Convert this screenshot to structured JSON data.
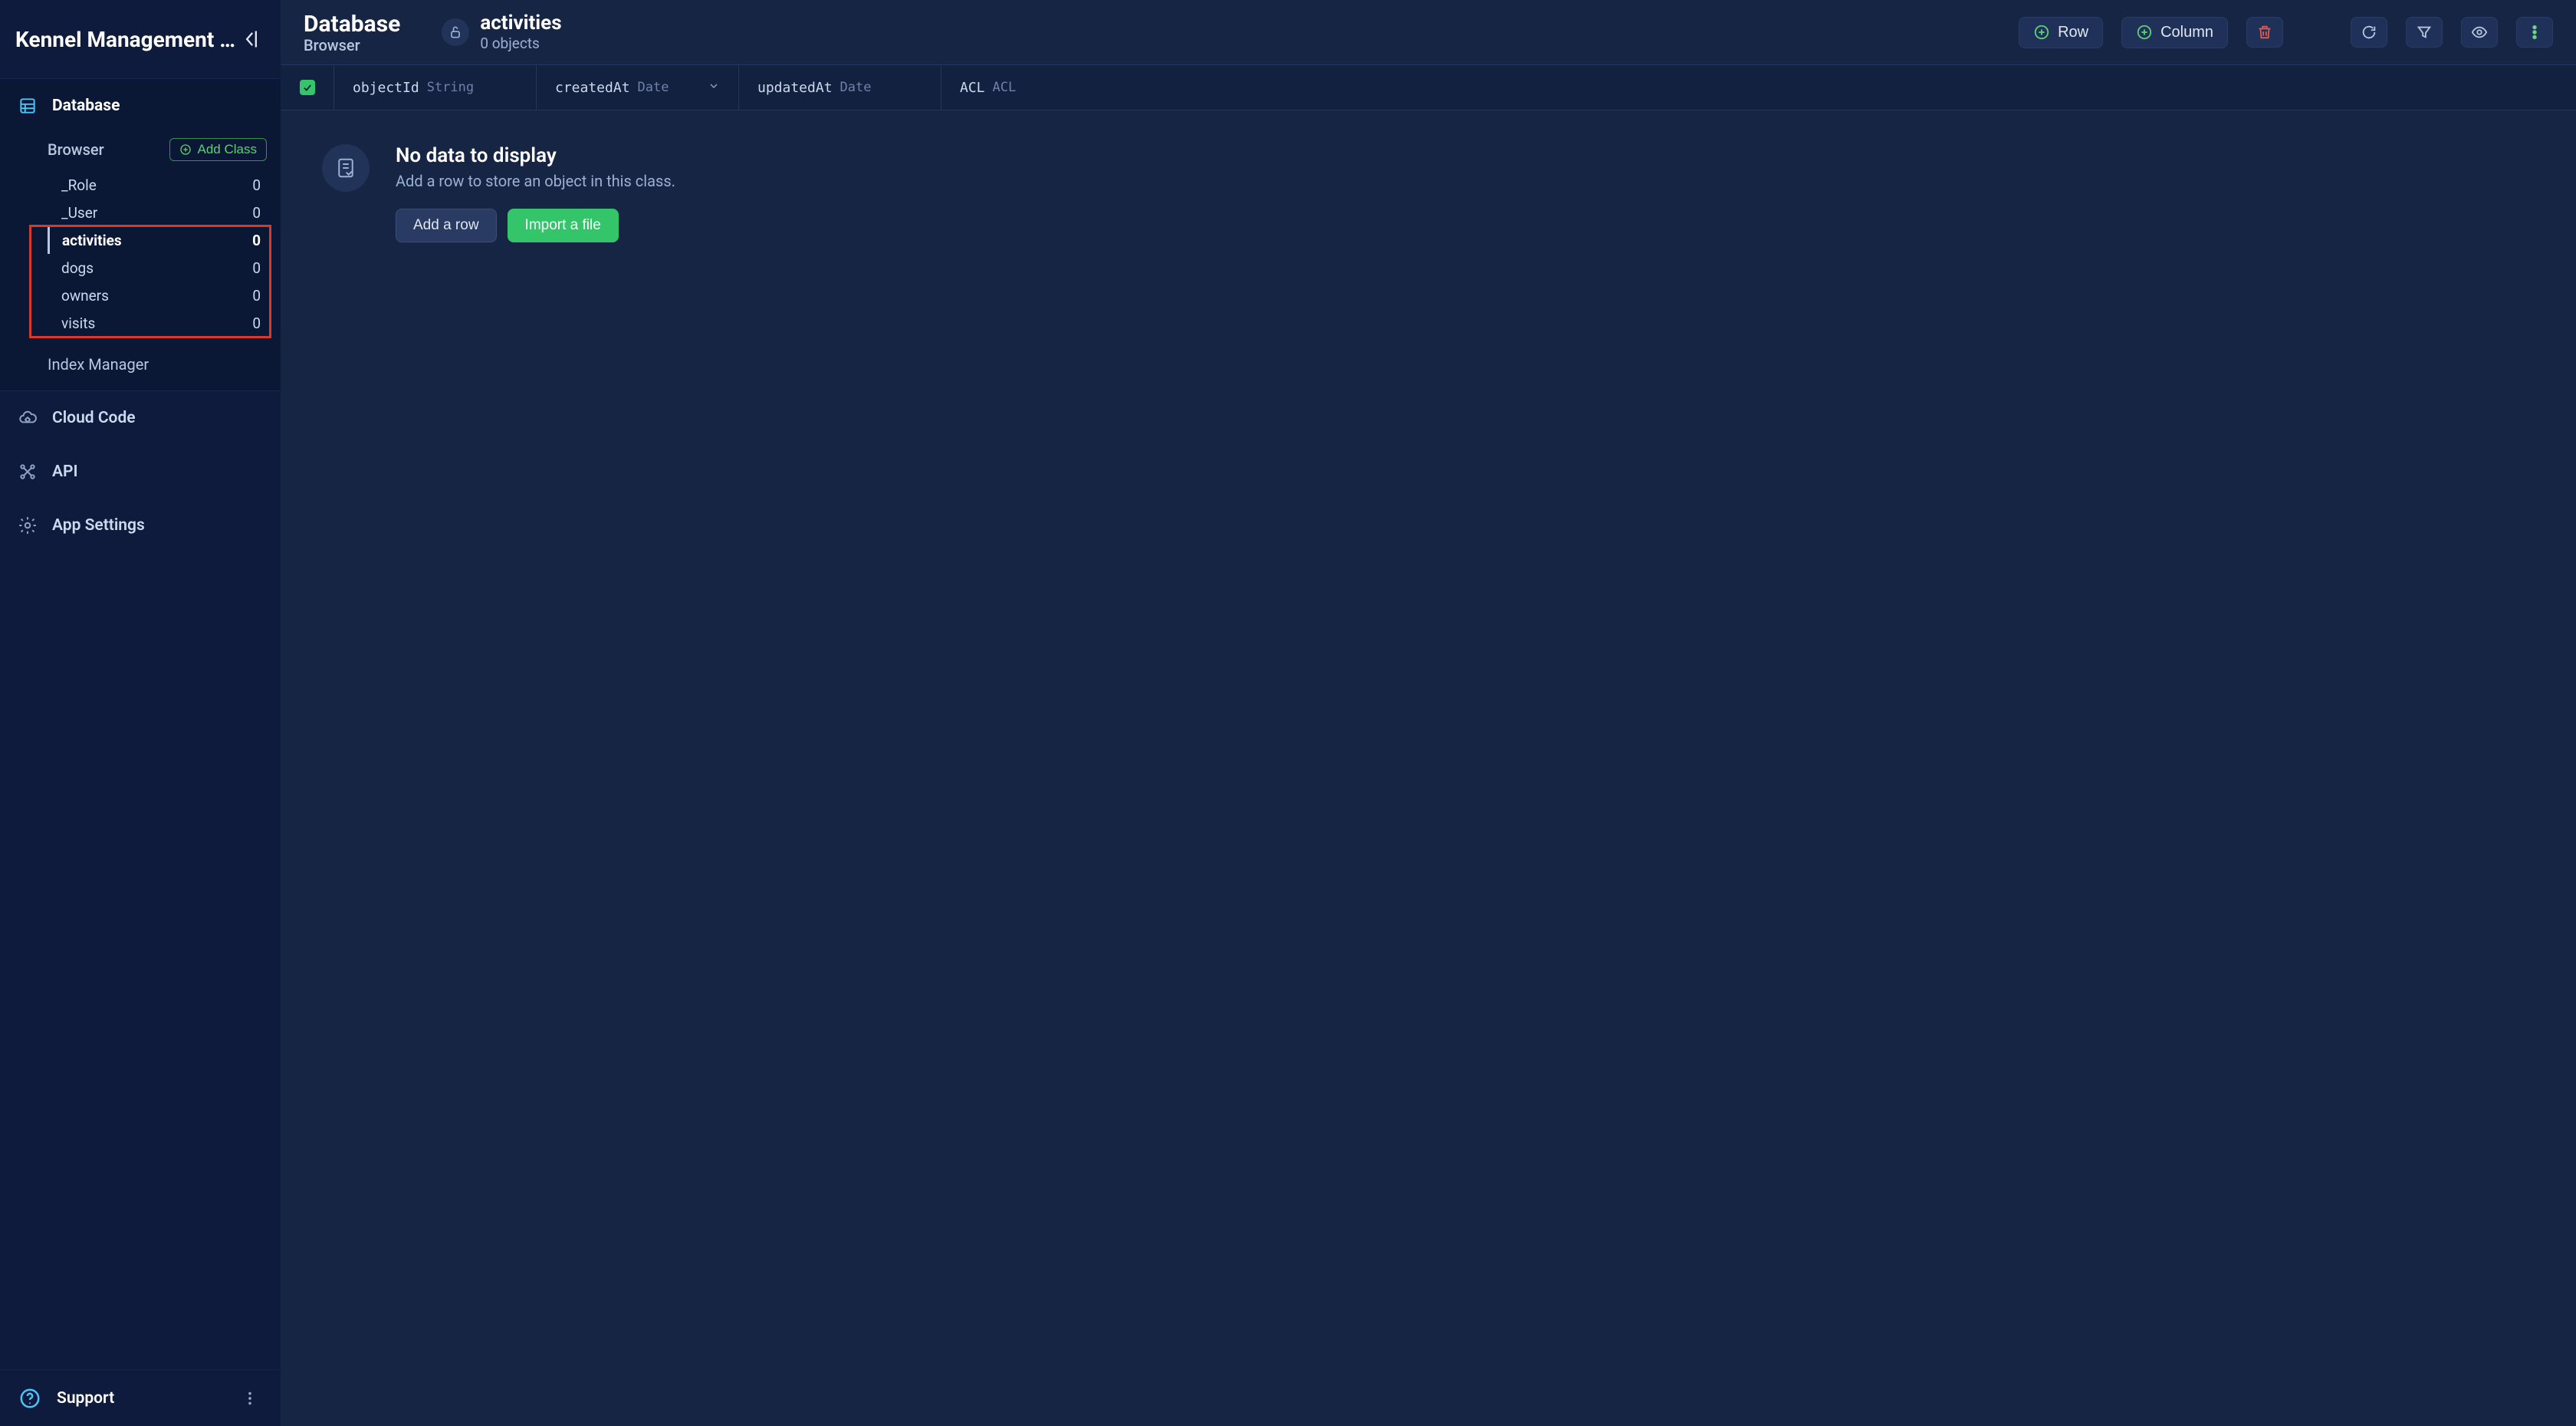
{
  "app_name": "Kennel Management …",
  "sidebar": {
    "database_label": "Database",
    "browser_label": "Browser",
    "add_class_label": "Add Class",
    "classes": [
      {
        "name": "_Role",
        "count": "0"
      },
      {
        "name": "_User",
        "count": "0"
      },
      {
        "name": "activities",
        "count": "0"
      },
      {
        "name": "dogs",
        "count": "0"
      },
      {
        "name": "owners",
        "count": "0"
      },
      {
        "name": "visits",
        "count": "0"
      }
    ],
    "index_manager_label": "Index Manager",
    "cloud_code_label": "Cloud Code",
    "api_label": "API",
    "app_settings_label": "App Settings",
    "support_label": "Support"
  },
  "header": {
    "breadcrumb_main": "Database",
    "breadcrumb_sub": "Browser",
    "class_name": "activities",
    "class_count": "0 objects",
    "row_btn": "Row",
    "column_btn": "Column"
  },
  "columns": {
    "objectId": {
      "name": "objectId",
      "type": "String"
    },
    "createdAt": {
      "name": "createdAt",
      "type": "Date"
    },
    "updatedAt": {
      "name": "updatedAt",
      "type": "Date"
    },
    "acl": {
      "name": "ACL",
      "type": "ACL"
    }
  },
  "empty": {
    "title": "No data to display",
    "subtitle": "Add a row to store an object in this class.",
    "add_row_btn": "Add a row",
    "import_btn": "Import a file"
  }
}
